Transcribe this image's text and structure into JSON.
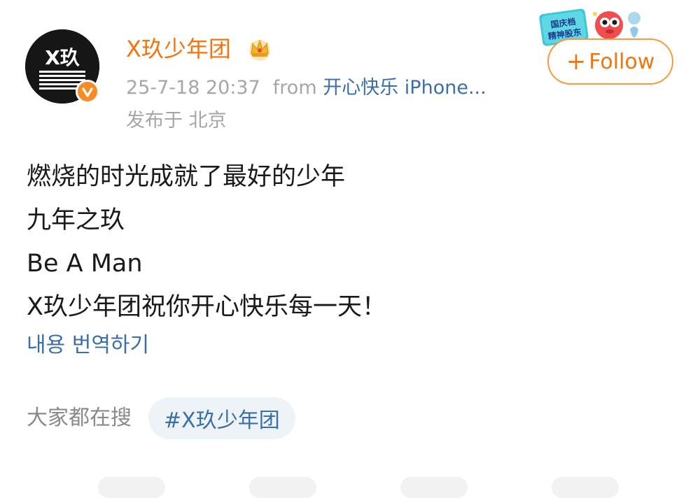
{
  "post": {
    "username": "X玖少年团",
    "timestamp": "25-7-18 20:37",
    "from_label": "from",
    "source": "开心快乐 iPhone...",
    "location": "发布于 北京",
    "follow_button": {
      "plus": "+",
      "label": "Follow"
    },
    "lines": [
      "燃烧的时光成就了最好的少年",
      "九年之玖",
      "Be A Man",
      "X玖少年团祝你开心快乐每一天！"
    ],
    "translate_label": "내용 번역하기",
    "searching": {
      "label": "大家都在搜",
      "topic": "#X玖少年团"
    },
    "badge_logo_text": "X玖",
    "decoration_text": "国庆档 精神股东"
  },
  "colors": {
    "username": "#f4740d",
    "link": "#3a6fa8",
    "meta": "#a6a6a6",
    "verified_badge": "#f78b25",
    "follow_border": "#f79a3c",
    "topic_pill_bg": "#eef3f8"
  },
  "icons": {
    "verified": "verified-badge-icon",
    "crown": "crown-icon",
    "follow_plus": "plus-icon"
  }
}
